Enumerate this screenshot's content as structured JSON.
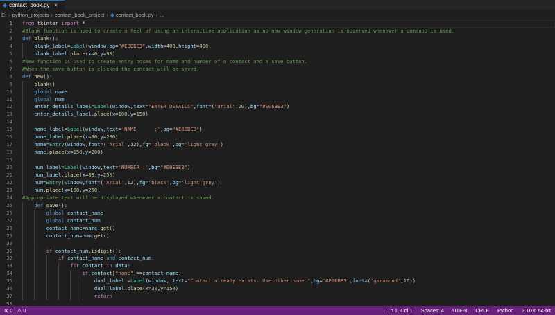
{
  "tab": {
    "filename": "contact_book.py",
    "icon": "python-file-icon"
  },
  "breadcrumb": [
    "E:",
    "python_projects",
    "contact_book_project",
    "contact_book.py",
    "..."
  ],
  "status": {
    "errors": "0",
    "warnings": "0",
    "position": "Ln 1, Col 1",
    "spaces": "Spaces: 4",
    "encoding": "UTF-8",
    "eol": "CRLF",
    "language": "Python",
    "interpreter": "3.10.6 64-bit"
  },
  "colors": {
    "statusbar": "#68217a",
    "editor_bg": "#1e1e1e",
    "keyword": "#c586c0",
    "comment": "#6a9955",
    "string": "#ce9178",
    "function": "#dcdcaa"
  },
  "lines": [
    {
      "n": "1",
      "indent": 0,
      "tokens": [
        [
          "from",
          "kw"
        ],
        [
          " tkinter ",
          ""
        ],
        [
          "import",
          "kw"
        ],
        [
          " *",
          ""
        ]
      ]
    },
    {
      "n": "2",
      "indent": 0,
      "tokens": [
        [
          "#Blank function is used to create a feel of using an interactive application as no new window generation is observed whenever a command is used.",
          "cmt"
        ]
      ]
    },
    {
      "n": "3",
      "indent": 0,
      "tokens": [
        [
          "def",
          "def"
        ],
        [
          " ",
          ""
        ],
        [
          "blank",
          "fn"
        ],
        [
          "():",
          ""
        ]
      ]
    },
    {
      "n": "4",
      "indent": 1,
      "tokens": [
        [
          "blank_label",
          "var"
        ],
        [
          "=",
          ""
        ],
        [
          "Label",
          "cls"
        ],
        [
          "(",
          ""
        ],
        [
          "window",
          "var"
        ],
        [
          ",",
          ""
        ],
        [
          "bg",
          "var"
        ],
        [
          "=",
          ""
        ],
        [
          "\"#E0EBE3\"",
          "str"
        ],
        [
          ",",
          ""
        ],
        [
          "width",
          "var"
        ],
        [
          "=",
          ""
        ],
        [
          "400",
          "num"
        ],
        [
          ",",
          ""
        ],
        [
          "height",
          "var"
        ],
        [
          "=",
          ""
        ],
        [
          "400",
          "num"
        ],
        [
          ")",
          ""
        ]
      ]
    },
    {
      "n": "5",
      "indent": 1,
      "tokens": [
        [
          "blank_label",
          "var"
        ],
        [
          ".",
          ""
        ],
        [
          "place",
          "fn"
        ],
        [
          "(",
          ""
        ],
        [
          "x",
          "var"
        ],
        [
          "=",
          ""
        ],
        [
          "0",
          "num"
        ],
        [
          ",",
          ""
        ],
        [
          "y",
          "var"
        ],
        [
          "=",
          ""
        ],
        [
          "90",
          "num"
        ],
        [
          ")",
          ""
        ]
      ]
    },
    {
      "n": "6",
      "indent": 0,
      "tokens": [
        [
          "#New function is used to create entry boxes for name and number of a contact and a save button.",
          "cmt"
        ]
      ]
    },
    {
      "n": "7",
      "indent": 0,
      "tokens": [
        [
          "#When the save button is clicked the contact will be saved.",
          "cmt"
        ]
      ]
    },
    {
      "n": "8",
      "indent": 0,
      "tokens": [
        [
          "def",
          "def"
        ],
        [
          " ",
          ""
        ],
        [
          "new",
          "fn"
        ],
        [
          "():",
          ""
        ]
      ]
    },
    {
      "n": "9",
      "indent": 1,
      "tokens": [
        [
          "blank",
          "fn"
        ],
        [
          "()",
          ""
        ]
      ]
    },
    {
      "n": "10",
      "indent": 1,
      "tokens": [
        [
          "global",
          "def"
        ],
        [
          " ",
          ""
        ],
        [
          "name",
          "var"
        ]
      ]
    },
    {
      "n": "11",
      "indent": 1,
      "tokens": [
        [
          "global",
          "def"
        ],
        [
          " ",
          ""
        ],
        [
          "num",
          "var"
        ]
      ]
    },
    {
      "n": "12",
      "indent": 1,
      "tokens": [
        [
          "enter_details_label",
          "var"
        ],
        [
          "=",
          ""
        ],
        [
          "Label",
          "cls"
        ],
        [
          "(",
          ""
        ],
        [
          "window",
          "var"
        ],
        [
          ",",
          ""
        ],
        [
          "text",
          "var"
        ],
        [
          "=",
          ""
        ],
        [
          "\"ENTER DETAILS\"",
          "str"
        ],
        [
          ",",
          ""
        ],
        [
          "font",
          "var"
        ],
        [
          "=(",
          ""
        ],
        [
          "\"arial\"",
          "str"
        ],
        [
          ",",
          ""
        ],
        [
          "20",
          "num"
        ],
        [
          "),",
          ""
        ],
        [
          "bg",
          "var"
        ],
        [
          "=",
          ""
        ],
        [
          "\"#E0EBE3\"",
          "str"
        ],
        [
          ")",
          ""
        ]
      ]
    },
    {
      "n": "13",
      "indent": 1,
      "tokens": [
        [
          "enter_details_label",
          "var"
        ],
        [
          ".",
          ""
        ],
        [
          "place",
          "fn"
        ],
        [
          "(",
          ""
        ],
        [
          "x",
          "var"
        ],
        [
          "=",
          ""
        ],
        [
          "100",
          "num"
        ],
        [
          ",",
          ""
        ],
        [
          "y",
          "var"
        ],
        [
          "=",
          ""
        ],
        [
          "150",
          "num"
        ],
        [
          ")",
          ""
        ]
      ]
    },
    {
      "n": "14",
      "indent": 1,
      "tokens": []
    },
    {
      "n": "15",
      "indent": 1,
      "tokens": [
        [
          "name_label",
          "var"
        ],
        [
          "=",
          ""
        ],
        [
          "Label",
          "cls"
        ],
        [
          "(",
          ""
        ],
        [
          "window",
          "var"
        ],
        [
          ",",
          ""
        ],
        [
          "text",
          "var"
        ],
        [
          "=",
          ""
        ],
        [
          "'NAME      :'",
          "str"
        ],
        [
          ",",
          ""
        ],
        [
          "bg",
          "var"
        ],
        [
          "=",
          ""
        ],
        [
          "\"#E0EBE3\"",
          "str"
        ],
        [
          ")",
          ""
        ]
      ]
    },
    {
      "n": "16",
      "indent": 1,
      "tokens": [
        [
          "name_label",
          "var"
        ],
        [
          ".",
          ""
        ],
        [
          "place",
          "fn"
        ],
        [
          "(",
          ""
        ],
        [
          "x",
          "var"
        ],
        [
          "=",
          ""
        ],
        [
          "80",
          "num"
        ],
        [
          ",",
          ""
        ],
        [
          "y",
          "var"
        ],
        [
          "=",
          ""
        ],
        [
          "200",
          "num"
        ],
        [
          ")",
          ""
        ]
      ]
    },
    {
      "n": "17",
      "indent": 1,
      "tokens": [
        [
          "name",
          "var"
        ],
        [
          "=",
          ""
        ],
        [
          "Entry",
          "cls"
        ],
        [
          "(",
          ""
        ],
        [
          "window",
          "var"
        ],
        [
          ",",
          ""
        ],
        [
          "font",
          "var"
        ],
        [
          "=(",
          ""
        ],
        [
          "'Arial'",
          "str"
        ],
        [
          ",",
          ""
        ],
        [
          "12",
          "num"
        ],
        [
          "),",
          ""
        ],
        [
          "fg",
          "var"
        ],
        [
          "=",
          ""
        ],
        [
          "'black'",
          "str"
        ],
        [
          ",",
          ""
        ],
        [
          "bg",
          "var"
        ],
        [
          "=",
          ""
        ],
        [
          "'light grey'",
          "str"
        ],
        [
          ")",
          ""
        ]
      ]
    },
    {
      "n": "18",
      "indent": 1,
      "tokens": [
        [
          "name",
          "var"
        ],
        [
          ".",
          ""
        ],
        [
          "place",
          "fn"
        ],
        [
          "(",
          ""
        ],
        [
          "x",
          "var"
        ],
        [
          "=",
          ""
        ],
        [
          "150",
          "num"
        ],
        [
          ",",
          ""
        ],
        [
          "y",
          "var"
        ],
        [
          "=",
          ""
        ],
        [
          "200",
          "num"
        ],
        [
          ")",
          ""
        ]
      ]
    },
    {
      "n": "19",
      "indent": 1,
      "tokens": []
    },
    {
      "n": "20",
      "indent": 1,
      "tokens": [
        [
          "num_label",
          "var"
        ],
        [
          "=",
          ""
        ],
        [
          "Label",
          "cls"
        ],
        [
          "(",
          ""
        ],
        [
          "window",
          "var"
        ],
        [
          ",",
          ""
        ],
        [
          "text",
          "var"
        ],
        [
          "=",
          ""
        ],
        [
          "'NUMBER :'",
          "str"
        ],
        [
          ",",
          ""
        ],
        [
          "bg",
          "var"
        ],
        [
          "=",
          ""
        ],
        [
          "\"#E0EBE3\"",
          "str"
        ],
        [
          ")",
          ""
        ]
      ]
    },
    {
      "n": "21",
      "indent": 1,
      "tokens": [
        [
          "num_label",
          "var"
        ],
        [
          ".",
          ""
        ],
        [
          "place",
          "fn"
        ],
        [
          "(",
          ""
        ],
        [
          "x",
          "var"
        ],
        [
          "=",
          ""
        ],
        [
          "80",
          "num"
        ],
        [
          ",",
          ""
        ],
        [
          "y",
          "var"
        ],
        [
          "=",
          ""
        ],
        [
          "250",
          "num"
        ],
        [
          ")",
          ""
        ]
      ]
    },
    {
      "n": "22",
      "indent": 1,
      "tokens": [
        [
          "num",
          "var"
        ],
        [
          "=",
          ""
        ],
        [
          "Entry",
          "cls"
        ],
        [
          "(",
          ""
        ],
        [
          "window",
          "var"
        ],
        [
          ",",
          ""
        ],
        [
          "font",
          "var"
        ],
        [
          "=(",
          ""
        ],
        [
          "'Arial'",
          "str"
        ],
        [
          ",",
          ""
        ],
        [
          "12",
          "num"
        ],
        [
          "),",
          ""
        ],
        [
          "fg",
          "var"
        ],
        [
          "=",
          ""
        ],
        [
          "'black'",
          "str"
        ],
        [
          ",",
          ""
        ],
        [
          "bg",
          "var"
        ],
        [
          "=",
          ""
        ],
        [
          "'light grey'",
          "str"
        ],
        [
          ")",
          ""
        ]
      ]
    },
    {
      "n": "23",
      "indent": 1,
      "tokens": [
        [
          "num",
          "var"
        ],
        [
          ".",
          ""
        ],
        [
          "place",
          "fn"
        ],
        [
          "(",
          ""
        ],
        [
          "x",
          "var"
        ],
        [
          "=",
          ""
        ],
        [
          "150",
          "num"
        ],
        [
          ",",
          ""
        ],
        [
          "y",
          "var"
        ],
        [
          "=",
          ""
        ],
        [
          "250",
          "num"
        ],
        [
          ")",
          ""
        ]
      ]
    },
    {
      "n": "24",
      "indent": 0,
      "tokens": [
        [
          "#Appropriate text will be displayed whenever a contact is saved.",
          "cmt"
        ]
      ]
    },
    {
      "n": "25",
      "indent": 1,
      "tokens": [
        [
          "def",
          "def"
        ],
        [
          " ",
          ""
        ],
        [
          "save",
          "fn"
        ],
        [
          "():",
          ""
        ]
      ]
    },
    {
      "n": "26",
      "indent": 2,
      "tokens": [
        [
          "global",
          "def"
        ],
        [
          " ",
          ""
        ],
        [
          "contact_name",
          "var"
        ]
      ]
    },
    {
      "n": "27",
      "indent": 2,
      "tokens": [
        [
          "global",
          "def"
        ],
        [
          " ",
          ""
        ],
        [
          "contact_num",
          "var"
        ]
      ]
    },
    {
      "n": "28",
      "indent": 2,
      "tokens": [
        [
          "contact_name",
          "var"
        ],
        [
          "=",
          ""
        ],
        [
          "name",
          "var"
        ],
        [
          ".",
          ""
        ],
        [
          "get",
          "fn"
        ],
        [
          "()",
          ""
        ]
      ]
    },
    {
      "n": "29",
      "indent": 2,
      "tokens": [
        [
          "contact_num",
          "var"
        ],
        [
          "=",
          ""
        ],
        [
          "num",
          "var"
        ],
        [
          ".",
          ""
        ],
        [
          "get",
          "fn"
        ],
        [
          "()",
          ""
        ]
      ]
    },
    {
      "n": "30",
      "indent": 2,
      "tokens": []
    },
    {
      "n": "31",
      "indent": 2,
      "tokens": [
        [
          "if",
          "kw"
        ],
        [
          " ",
          ""
        ],
        [
          "contact_num",
          "var"
        ],
        [
          ".",
          ""
        ],
        [
          "isdigit",
          "fn"
        ],
        [
          "():",
          ""
        ]
      ]
    },
    {
      "n": "32",
      "indent": 3,
      "tokens": [
        [
          "if",
          "kw"
        ],
        [
          " ",
          ""
        ],
        [
          "contact_name",
          "var"
        ],
        [
          " ",
          ""
        ],
        [
          "and",
          "def"
        ],
        [
          " ",
          ""
        ],
        [
          "contact_num",
          "var"
        ],
        [
          ":",
          ""
        ]
      ]
    },
    {
      "n": "33",
      "indent": 4,
      "tokens": [
        [
          "for",
          "kw"
        ],
        [
          " ",
          ""
        ],
        [
          "contact",
          "var"
        ],
        [
          " ",
          ""
        ],
        [
          "in",
          "kw"
        ],
        [
          " ",
          ""
        ],
        [
          "data",
          "var"
        ],
        [
          ":",
          ""
        ]
      ]
    },
    {
      "n": "34",
      "indent": 5,
      "tokens": [
        [
          "if",
          "kw"
        ],
        [
          " ",
          ""
        ],
        [
          "contact",
          "var"
        ],
        [
          "[",
          ""
        ],
        [
          "\"name\"",
          "str"
        ],
        [
          "]==",
          ""
        ],
        [
          "contact_name",
          "var"
        ],
        [
          ":",
          ""
        ]
      ]
    },
    {
      "n": "35",
      "indent": 6,
      "tokens": [
        [
          "dual_label",
          "var"
        ],
        [
          " =",
          ""
        ],
        [
          "Label",
          "cls"
        ],
        [
          "(",
          ""
        ],
        [
          "window",
          "var"
        ],
        [
          ", ",
          ""
        ],
        [
          "text",
          "var"
        ],
        [
          "=",
          ""
        ],
        [
          "\"Contact already exists. Use other name.\"",
          "str"
        ],
        [
          ",",
          ""
        ],
        [
          "bg",
          "var"
        ],
        [
          "=",
          ""
        ],
        [
          "'#E0EBE3'",
          "str"
        ],
        [
          ",",
          ""
        ],
        [
          "font",
          "var"
        ],
        [
          "=(",
          ""
        ],
        [
          "'garamond'",
          "str"
        ],
        [
          ",",
          ""
        ],
        [
          "16",
          "num"
        ],
        [
          "))",
          ""
        ]
      ]
    },
    {
      "n": "36",
      "indent": 6,
      "tokens": [
        [
          "dual_label",
          "var"
        ],
        [
          ".",
          ""
        ],
        [
          "place",
          "fn"
        ],
        [
          "(",
          ""
        ],
        [
          "x",
          "var"
        ],
        [
          "=",
          ""
        ],
        [
          "30",
          "num"
        ],
        [
          ",",
          ""
        ],
        [
          "y",
          "var"
        ],
        [
          "=",
          ""
        ],
        [
          "150",
          "num"
        ],
        [
          ")",
          ""
        ]
      ]
    },
    {
      "n": "37",
      "indent": 6,
      "tokens": [
        [
          "return",
          "kw"
        ]
      ]
    },
    {
      "n": "38",
      "indent": 0,
      "tokens": []
    }
  ]
}
